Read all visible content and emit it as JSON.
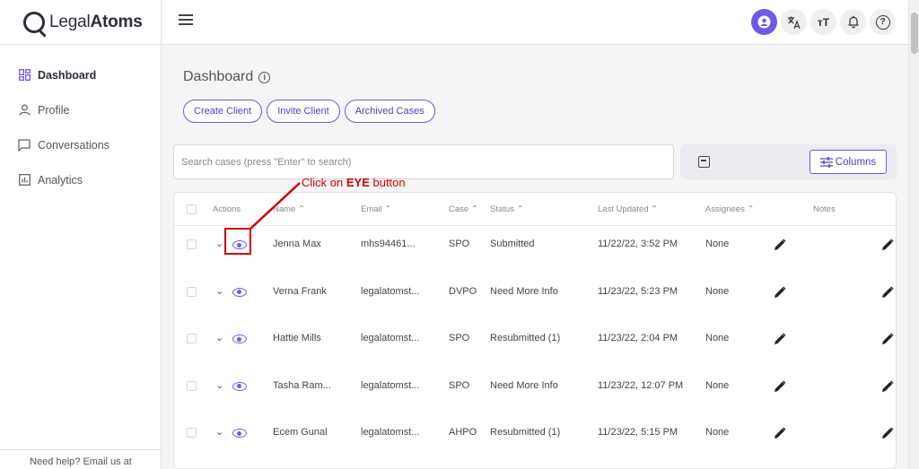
{
  "brand": {
    "logo_light": "Legal",
    "logo_bold": "Atoms"
  },
  "sidebar": {
    "items": [
      {
        "label": "Dashboard",
        "icon": "dashboard-grid-icon",
        "active": true
      },
      {
        "label": "Profile",
        "icon": "person-icon",
        "active": false
      },
      {
        "label": "Conversations",
        "icon": "chat-icon",
        "active": false
      },
      {
        "label": "Analytics",
        "icon": "bar-chart-icon",
        "active": false
      }
    ],
    "help_text": "Need help? Email us at"
  },
  "header": {
    "icons": [
      "account-icon",
      "translate-icon",
      "text-size-icon",
      "bell-icon",
      "help-icon"
    ],
    "text_size_glyph": "тT",
    "help_glyph": "?"
  },
  "main": {
    "title": "Dashboard",
    "info_glyph": "i",
    "buttons": {
      "create": "Create Client",
      "invite": "Invite Client",
      "archived": "Archived Cases"
    },
    "search_placeholder": "Search cases (press \"Enter\" to search)",
    "columns_label": "Columns"
  },
  "table": {
    "headers": {
      "actions": "Actions",
      "name": "Name ⌃",
      "email": "Email ⌃",
      "case": "Case ⌃",
      "status": "Status ⌃",
      "updated": "Last Updated ⌃",
      "assignees": "Assignees ⌃",
      "notes": "Notes"
    },
    "rows": [
      {
        "name": "Jenna Max",
        "email": "mhs94461...",
        "case": "SPO",
        "status": "Submitted",
        "updated": "11/22/22, 3:52 PM",
        "assignees": "None"
      },
      {
        "name": "Verna Frank",
        "email": "legalatomst...",
        "case": "DVPO",
        "status": "Need More Info",
        "updated": "11/23/22, 5:23 PM",
        "assignees": "None"
      },
      {
        "name": "Hattie Mills",
        "email": "legalatomst...",
        "case": "SPO",
        "status": "Resubmitted (1)",
        "updated": "11/23/22, 2:04 PM",
        "assignees": "None"
      },
      {
        "name": "Tasha Ram...",
        "email": "legalatomst...",
        "case": "SPO",
        "status": "Need More Info",
        "updated": "11/23/22, 12:07 PM",
        "assignees": "None"
      },
      {
        "name": "Ecem Gunal",
        "email": "legalatomst...",
        "case": "AHPO",
        "status": "Resubmitted (1)",
        "updated": "11/23/22, 5:15 PM",
        "assignees": "None"
      }
    ]
  },
  "annotation": {
    "prefix": "Click on ",
    "bold": "EYE",
    "suffix": " button",
    "color": "#d40000"
  },
  "colors": {
    "accent": "#6b5be6"
  }
}
